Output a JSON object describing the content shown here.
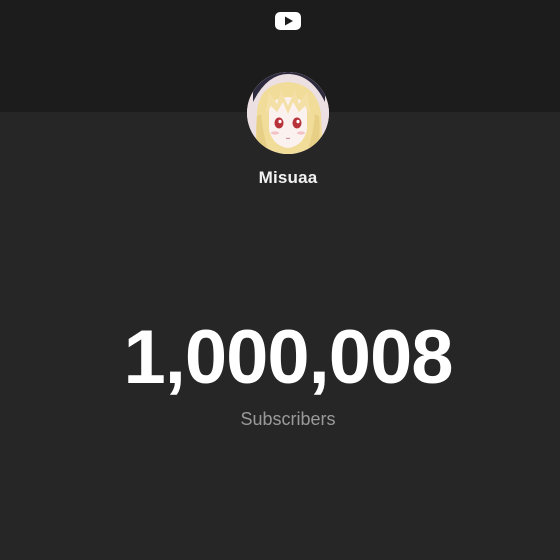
{
  "header": {
    "logo_icon": "youtube-play-icon",
    "logo_color": "#ffffff"
  },
  "channel": {
    "name": "Misuaa",
    "avatar_icon": "anime-girl-avatar"
  },
  "stats": {
    "subscriber_count": "1,000,008",
    "subscriber_label": "Subscribers"
  },
  "colors": {
    "background": "#262626",
    "header_band": "#1c1c1c",
    "count_text": "#ffffff",
    "label_text": "#9a9a9a"
  }
}
